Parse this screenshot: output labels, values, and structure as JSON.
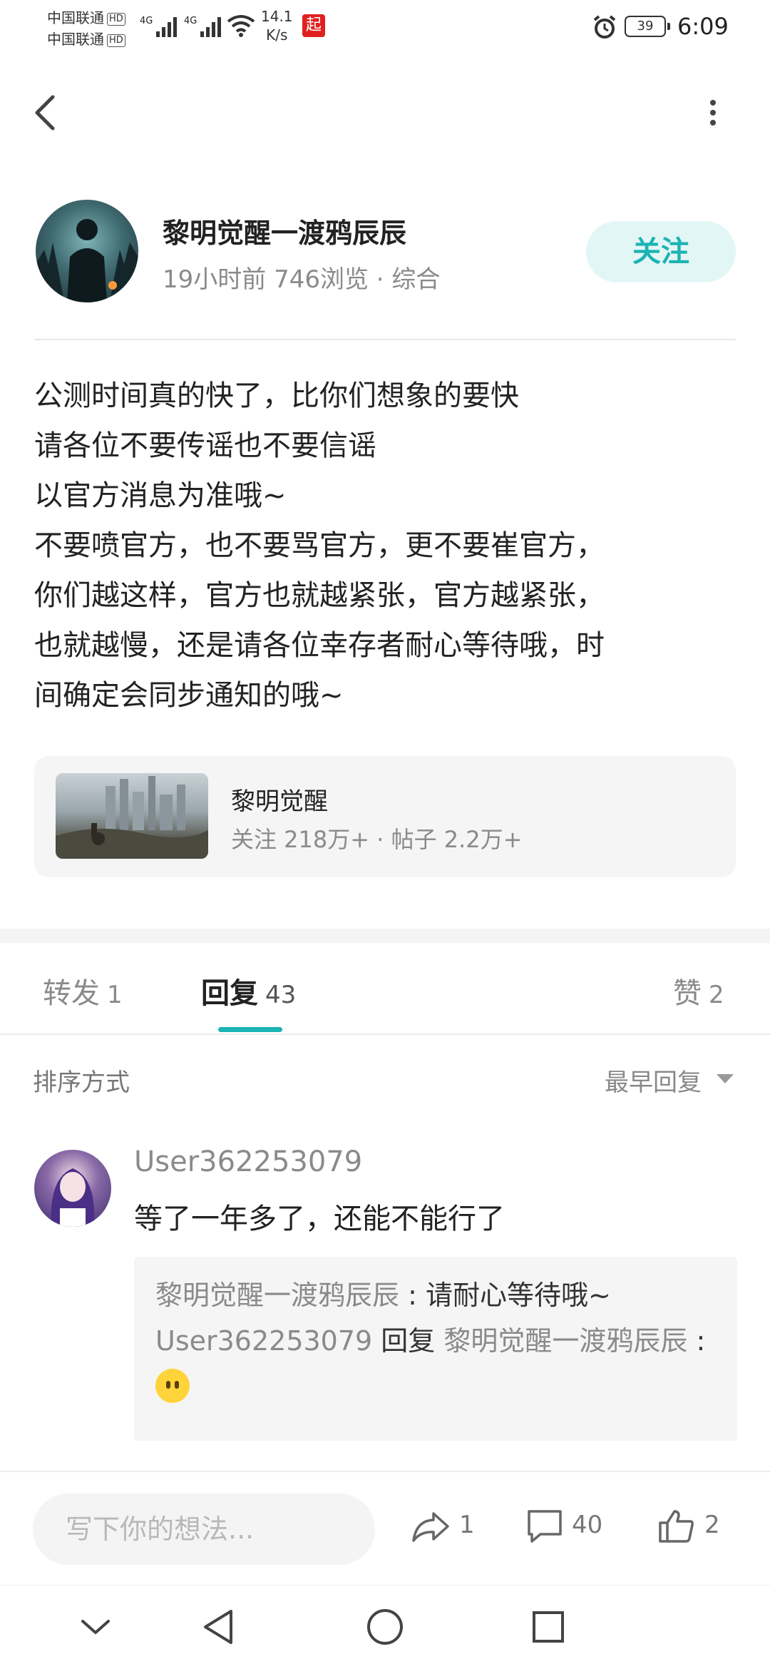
{
  "status_bar": {
    "carrier1": "中国联通",
    "carrier2": "中国联通",
    "hd": "HD",
    "net1": "4G",
    "net2": "4G",
    "speed_value": "14.1",
    "speed_unit": "K/s",
    "app_badge": "起",
    "battery": "39",
    "time": "6:09"
  },
  "author": {
    "name": "黎明觉醒一渡鸦辰辰",
    "meta": "19小时前  746浏览  ·  综合",
    "follow_label": "关注"
  },
  "post": {
    "body": "公测时间真的快了，比你们想象的要快\n请各位不要传谣也不要信谣\n以官方消息为准哦~\n不要喷官方，也不要骂官方，更不要崔官方，\n你们越这样，官方也就越紧张，官方越紧张，\n也就越慢，还是请各位幸存者耐心等待哦，时\n间确定会同步通知的哦~"
  },
  "forum": {
    "name": "黎明觉醒",
    "stats": "关注 218万+  ·  帖子 2.2万+"
  },
  "tabs": [
    {
      "label": "转发",
      "count": "1"
    },
    {
      "label": "回复",
      "count": "43"
    },
    {
      "label": "赞",
      "count": "2"
    }
  ],
  "sort": {
    "label": "排序方式",
    "value": "最早回复"
  },
  "comment": {
    "user": "User362253079",
    "text": "等了一年多了，还能不能行了",
    "replies": [
      {
        "name": "黎明觉醒一渡鸦辰辰",
        "sep": " : ",
        "text": "请耐心等待哦~"
      },
      {
        "name": "User362253079",
        "verb": " 回复 ",
        "target": "黎明觉醒一渡鸦辰辰",
        "sep": " : ",
        "emoji": "neutral-face"
      }
    ]
  },
  "bottom": {
    "input_placeholder": "写下你的想法...",
    "share_count": "1",
    "comment_count": "40",
    "like_count": "2"
  },
  "colors": {
    "accent": "#1bb3b3",
    "follow_bg": "#e3f6f6"
  }
}
